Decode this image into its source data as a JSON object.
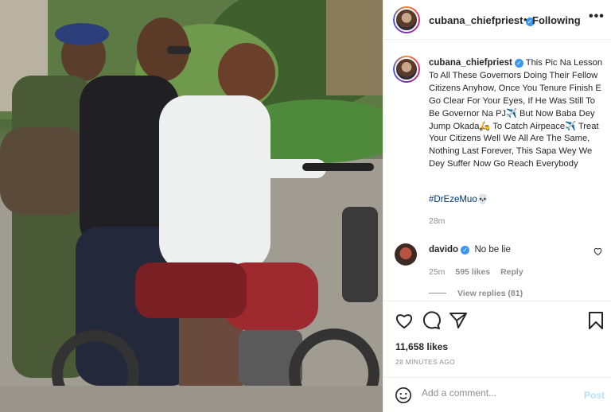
{
  "post": {
    "username": "cubana_chiefpriest",
    "follow_status": "Following",
    "separator": "•",
    "more_label": "•••",
    "caption": "This Pic Na Lesson To All These Governors Doing Their Fellow Citizens Anyhow, Once You Tenure Finish E Go Clear For Your Eyes, If He Was Still To Be Governor Na PJ✈️ But Now Baba Dey Jump Okada🛵 To Catch Airpeace✈️ Treat Your Citizens Well We All Are The Same, Nothing Last Forever, This Sapa Wey We Dey Suffer Now Go Reach Everybody",
    "hashtag": "#DrEzeMuo💀",
    "time": "28m",
    "likes": "11,658 likes",
    "time_ago": "28 MINUTES AGO"
  },
  "comment": {
    "username": "davido",
    "text": "No be lie",
    "time": "25m",
    "likes": "595 likes",
    "reply": "Reply",
    "view_replies": "View replies (81)"
  },
  "add_comment": {
    "placeholder": "Add a comment...",
    "post_label": "Post"
  },
  "icons": {
    "verified": "verified-badge-icon",
    "heart": "heart-icon",
    "comment": "comment-icon",
    "share": "share-icon",
    "save": "bookmark-icon",
    "emoji": "smiley-icon"
  },
  "colors": {
    "verified": "#3897f0",
    "post_disabled": "#b2dffc",
    "hashtag": "#00376b",
    "muted": "#8e8e8e"
  }
}
